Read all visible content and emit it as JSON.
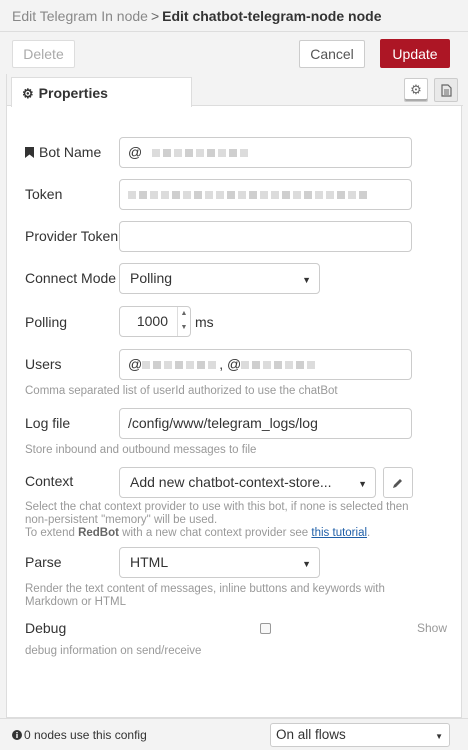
{
  "header": {
    "breadcrumb": "Edit Telegram In node",
    "separator": ">",
    "title": "Edit chatbot-telegram-node node"
  },
  "toolbar": {
    "delete_label": "Delete",
    "cancel_label": "Cancel",
    "update_label": "Update"
  },
  "tabs": {
    "properties_label": "Properties",
    "settings_icon": "gear-icon",
    "description_icon": "document-icon"
  },
  "form": {
    "bot_name_label": "Bot Name",
    "bot_name_prefix": "@",
    "token_label": "Token",
    "provider_token_label": "Provider Token",
    "provider_token_value": "",
    "connect_mode_label": "Connect Mode",
    "connect_mode_value": "Polling",
    "polling_label": "Polling",
    "polling_value": "1000",
    "polling_unit": "ms",
    "users_label": "Users",
    "users_prefix": "@",
    "users_separator": ", @",
    "users_help": "Comma separated list of userId authorized to use the chatBot",
    "log_file_label": "Log file",
    "log_file_value": "/config/www/telegram_logs/log",
    "log_file_help": "Store inbound and outbound messages to file",
    "context_label": "Context",
    "context_value": "Add new chatbot-context-store...",
    "context_help_1": "Select the chat context provider to use with this bot, if none is selected then non-persistent \"memory\" will be used.",
    "context_help_2a": "To extend",
    "context_help_2b": "RedBot",
    "context_help_2c": "with a new chat context provider see",
    "context_help_link": "this tutorial",
    "context_help_2d": ".",
    "parse_label": "Parse",
    "parse_value": "HTML",
    "parse_help": "Render the text content of messages, inline buttons and keywords with Markdown or HTML",
    "debug_label": "Debug",
    "debug_checked": false,
    "debug_show": "Show",
    "debug_help": "debug information on send/receive"
  },
  "footer": {
    "usage_text": "0 nodes use this config",
    "scope_value": "On all flows"
  },
  "colors": {
    "update_button": "#ad1625",
    "link": "#1f5fa8"
  }
}
